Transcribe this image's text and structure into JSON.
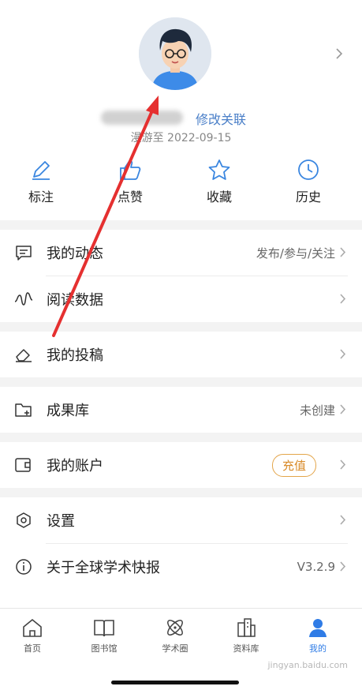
{
  "profile": {
    "edit_link": "修改关联",
    "since": "漫游至 2022-09-15"
  },
  "quick_actions": [
    {
      "label": "标注",
      "icon": "pencil-icon"
    },
    {
      "label": "点赞",
      "icon": "thumbs-up-icon"
    },
    {
      "label": "收藏",
      "icon": "star-icon"
    },
    {
      "label": "历史",
      "icon": "clock-icon"
    }
  ],
  "menu": {
    "dynamics": {
      "label": "我的动态",
      "value": "发布/参与/关注",
      "icon": "message-icon"
    },
    "reading": {
      "label": "阅读数据",
      "icon": "wave-icon"
    },
    "submissions": {
      "label": "我的投稿",
      "icon": "eraser-icon"
    },
    "achievements": {
      "label": "成果库",
      "value": "未创建",
      "icon": "folder-plus-icon"
    },
    "account": {
      "label": "我的账户",
      "badge": "充值",
      "icon": "wallet-icon"
    },
    "settings": {
      "label": "设置",
      "icon": "hexagon-gear-icon"
    },
    "about": {
      "label": "关于全球学术快报",
      "value": "V3.2.9",
      "icon": "info-icon"
    }
  },
  "tabs": [
    {
      "label": "首页",
      "icon": "home-icon"
    },
    {
      "label": "图书馆",
      "icon": "book-icon"
    },
    {
      "label": "学术圈",
      "icon": "atom-icon"
    },
    {
      "label": "资料库",
      "icon": "building-icon"
    },
    {
      "label": "我的",
      "icon": "user-icon"
    }
  ],
  "watermark": "jingyan.baidu.com",
  "colors": {
    "accent": "#2f7ce6",
    "link": "#4a7fc8",
    "badge": "#d88a28",
    "arrow": "#e53030"
  }
}
